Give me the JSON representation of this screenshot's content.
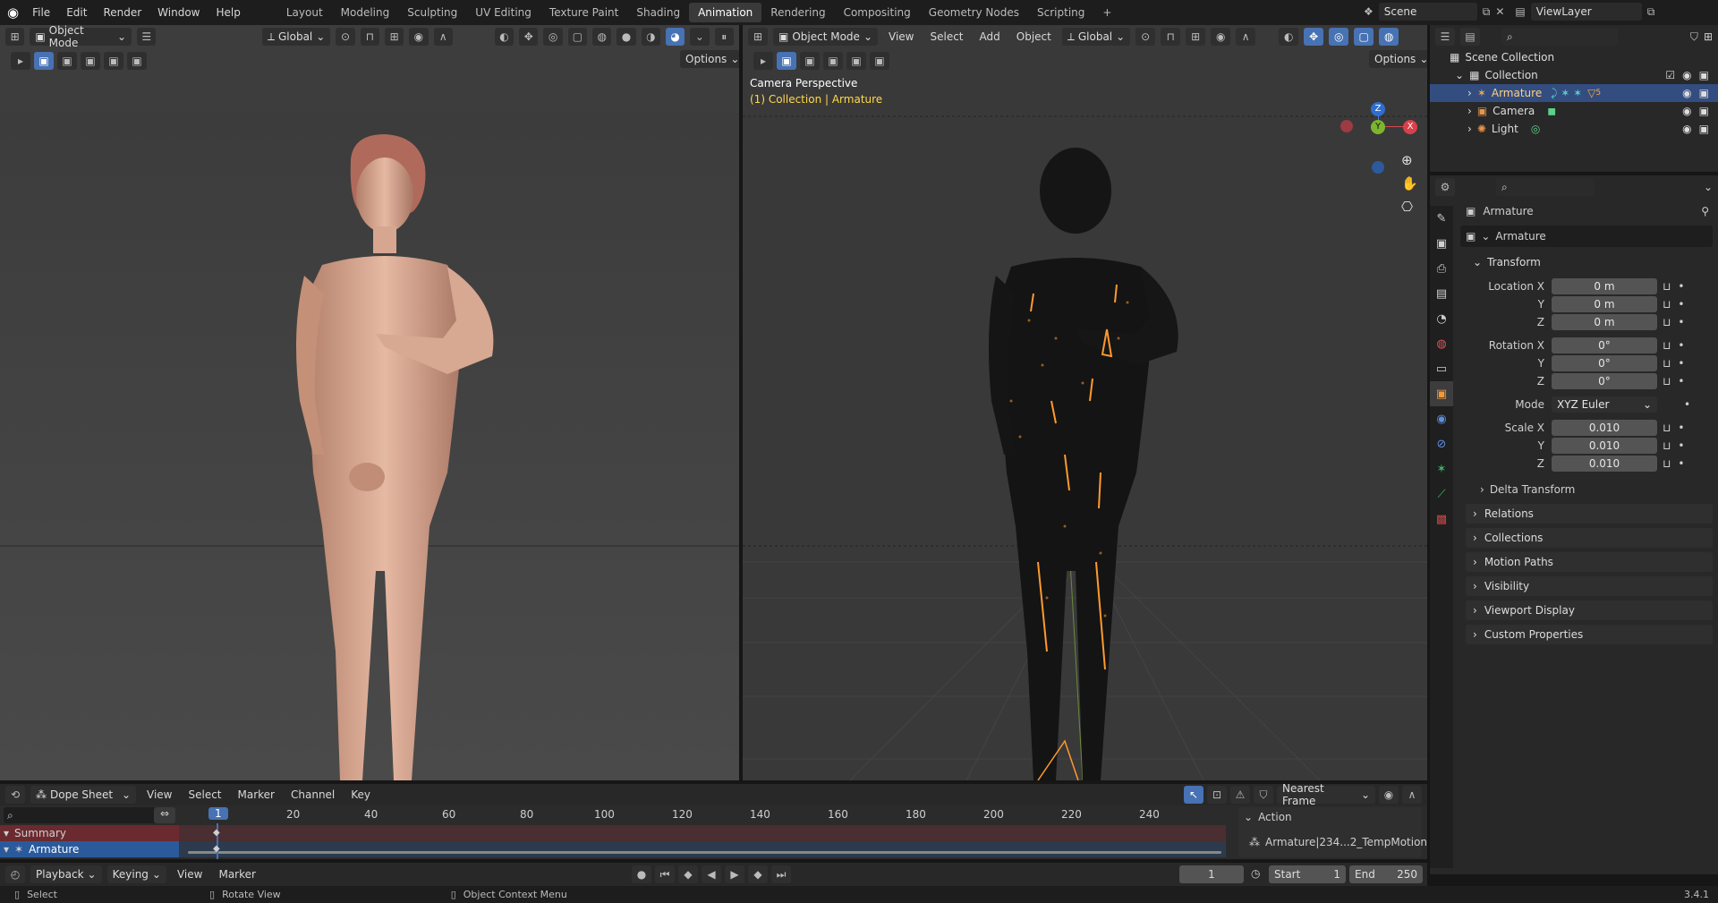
{
  "top_menu": [
    "File",
    "Edit",
    "Render",
    "Window",
    "Help"
  ],
  "workspaces": [
    "Layout",
    "Modeling",
    "Sculpting",
    "UV Editing",
    "Texture Paint",
    "Shading",
    "Animation",
    "Rendering",
    "Compositing",
    "Geometry Nodes",
    "Scripting"
  ],
  "active_workspace": "Animation",
  "scene_name": "Scene",
  "view_layer": "ViewLayer",
  "left_view": {
    "mode": "Object Mode",
    "orientation": "Global",
    "options": "Options"
  },
  "right_view": {
    "mode": "Object Mode",
    "menus": [
      "View",
      "Select",
      "Add",
      "Object"
    ],
    "orientation": "Global",
    "options": "Options",
    "overlay_title": "Camera Perspective",
    "overlay_sub": "(1) Collection | Armature",
    "gizmo": {
      "z": "Z",
      "y": "Y",
      "x": "X"
    }
  },
  "outliner": {
    "root": "Scene Collection",
    "collection": "Collection",
    "items": [
      {
        "name": "Armature",
        "selected": true
      },
      {
        "name": "Camera",
        "selected": false
      },
      {
        "name": "Light",
        "selected": false
      }
    ],
    "modifier_count": "5"
  },
  "properties": {
    "object_name": "Armature",
    "data_name": "Armature",
    "transform_label": "Transform",
    "location": {
      "label": "Location X",
      "x": "0 m",
      "y": "0 m",
      "z": "0 m"
    },
    "rotation": {
      "label": "Rotation X",
      "x": "0°",
      "y": "0°",
      "z": "0°"
    },
    "mode_label": "Mode",
    "mode_value": "XYZ Euler",
    "scale": {
      "label": "Scale X",
      "x": "0.010",
      "y": "0.010",
      "z": "0.010"
    },
    "axis_y": "Y",
    "axis_z": "Z",
    "delta": "Delta Transform",
    "panels": [
      "Relations",
      "Collections",
      "Motion Paths",
      "Visibility",
      "Viewport Display",
      "Custom Properties"
    ]
  },
  "dope": {
    "editor": "Dope Sheet",
    "menus": [
      "View",
      "Select",
      "Marker",
      "Channel",
      "Key"
    ],
    "snap": "Nearest Frame",
    "current_frame": "1",
    "ticks": [
      "20",
      "40",
      "60",
      "80",
      "100",
      "120",
      "140",
      "160",
      "180",
      "200",
      "220",
      "240"
    ],
    "channels": [
      "Summary",
      "Armature"
    ],
    "action_label": "Action",
    "action_name": "Armature|234...2_TempMotion"
  },
  "timeline": {
    "menus": [
      "Playback",
      "Keying",
      "View",
      "Marker"
    ],
    "frame": "1",
    "start_label": "Start",
    "start": "1",
    "end_label": "End",
    "end": "250"
  },
  "status": {
    "select": "Select",
    "rotate": "Rotate View",
    "context": "Object Context Menu",
    "version": "3.4.1"
  }
}
